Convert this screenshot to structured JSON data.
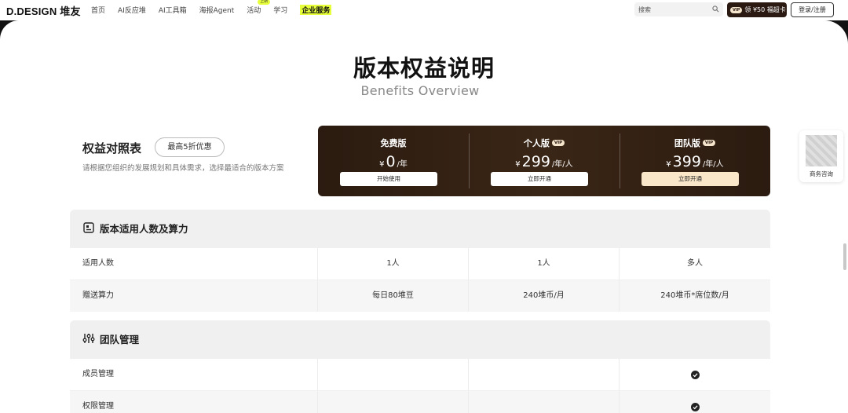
{
  "brand": {
    "logo": "D.DESIGN 堆友"
  },
  "nav": {
    "items": [
      "首页",
      "AI反应堆",
      "AI工具箱",
      "海报Agent",
      "活动",
      "学习",
      "企业服务"
    ],
    "activity_badge": "上新",
    "search_placeholder": "搜索",
    "vip_tag": "VIP",
    "vip_promo": "领 ¥50 福超卡",
    "login_label": "登录/注册"
  },
  "page": {
    "title": "版本权益说明",
    "subtitle": "Benefits Overview"
  },
  "compare": {
    "title": "权益对照表",
    "discount_label": "最高5折优惠",
    "description": "请根据您组织的发展规划和具体需求，选择最适合的版本方案"
  },
  "plans": [
    {
      "name": "免费版",
      "vip": "",
      "currency": "¥",
      "price": "0",
      "unit": "/年",
      "button": "开始使用"
    },
    {
      "name": "个人版",
      "vip": "VIP",
      "currency": "¥",
      "price": "299",
      "unit": "/年/人",
      "button": "立即开通"
    },
    {
      "name": "团队版",
      "vip": "VIP",
      "currency": "¥",
      "price": "399",
      "unit": "/年/人",
      "button": "立即开通"
    }
  ],
  "sections": [
    {
      "title": "版本适用人数及算力",
      "icon": "badge-icon",
      "rows": [
        {
          "label": "适用人数",
          "free": "1人",
          "personal": "1人",
          "team": "多人"
        },
        {
          "label": "赠送算力",
          "free": "每日80堆豆",
          "personal": "240堆币/月",
          "team": "240堆币*席位数/月"
        }
      ]
    },
    {
      "title": "团队管理",
      "icon": "sliders-icon",
      "rows": [
        {
          "label": "成员管理",
          "free": "",
          "personal": "",
          "team": "check"
        },
        {
          "label": "权限管理",
          "free": "",
          "personal": "",
          "team": "check"
        }
      ]
    }
  ],
  "floating": {
    "label": "商务咨询"
  },
  "colors": {
    "accent": "#e6ff3a",
    "plan_bg": "#2b1b10",
    "gold": "#fae6c8"
  }
}
